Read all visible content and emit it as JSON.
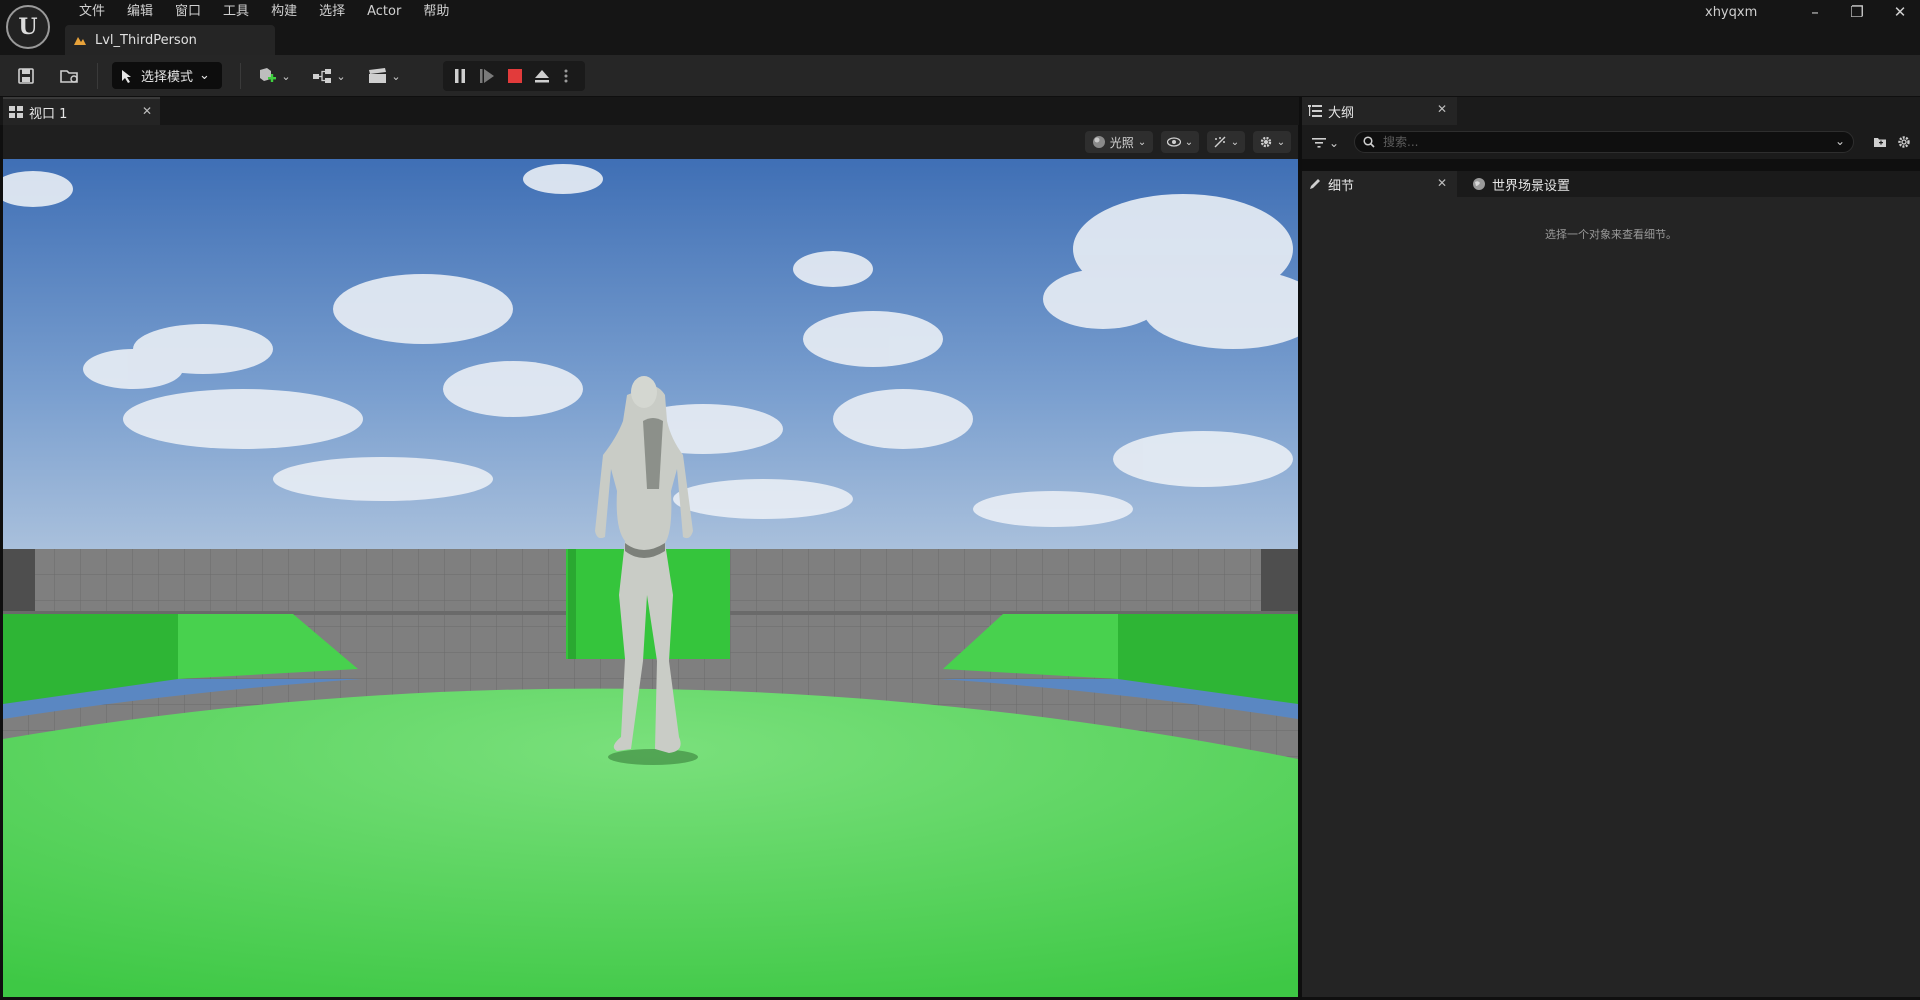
{
  "menubar": {
    "items": [
      "文件",
      "编辑",
      "窗口",
      "工具",
      "构建",
      "选择",
      "Actor",
      "帮助"
    ]
  },
  "map_tab": {
    "label": "Lvl_ThirdPerson"
  },
  "user": {
    "name": "xhyqxm"
  },
  "toolbar": {
    "mode_label": "选择模式"
  },
  "viewport": {
    "tab_label": "视口 1",
    "lighting_label": "光照"
  },
  "outliner": {
    "tab_label": "大纲",
    "search_placeholder": "搜索..."
  },
  "details": {
    "tab_label": "细节",
    "world_settings_label": "世界场景设置",
    "empty_message": "选择一个对象来查看细节。"
  },
  "colors": {
    "floor_green": "#4fd156",
    "sky_blue": "#5a87c2",
    "stop_red": "#e23b3b"
  }
}
